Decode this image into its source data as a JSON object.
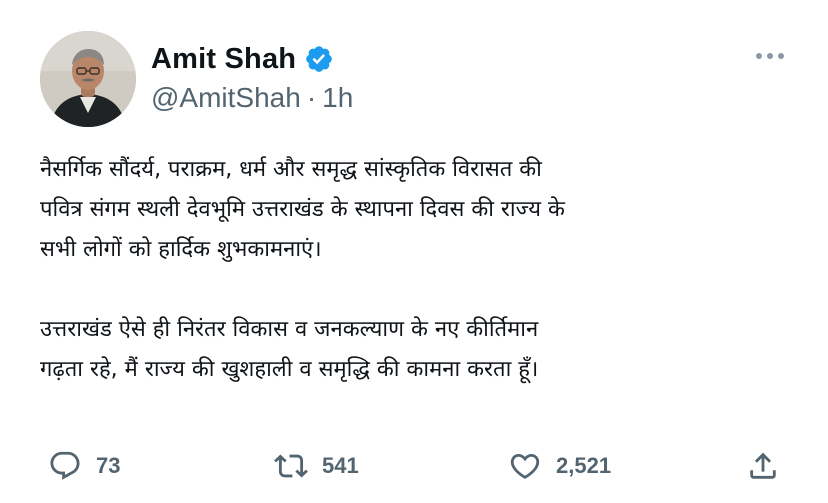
{
  "author": {
    "display_name": "Amit Shah",
    "handle": "@AmitShah",
    "separator": "·",
    "time": "1h",
    "verified": true
  },
  "tweet": {
    "paragraph1": [
      "नैसर्गिक सौंदर्य, पराक्रम, धर्म और समृद्ध सांस्कृतिक विरासत की",
      "पवित्र संगम स्थली देवभूमि उत्तराखंड के स्थापना दिवस की राज्य के",
      "सभी लोगों को हार्दिक शुभकामनाएं।"
    ],
    "paragraph2": [
      "उत्तराखंड ऐसे ही निरंतर विकास व जनकल्याण के नए कीर्तिमान",
      "गढ़ता रहे, मैं राज्य की खुशहाली व समृद्धि की कामना करता हूँ।"
    ]
  },
  "actions": {
    "replies": "73",
    "retweets": "541",
    "likes": "2,521"
  },
  "icons": {
    "verified": "verified-badge-icon",
    "reply": "reply-icon",
    "retweet": "retweet-icon",
    "like": "heart-icon",
    "share": "share-icon",
    "more": "more-icon"
  },
  "colors": {
    "text": "#0f1419",
    "secondary": "#536471",
    "verified": "#1d9bf0",
    "background": "#ffffff"
  }
}
